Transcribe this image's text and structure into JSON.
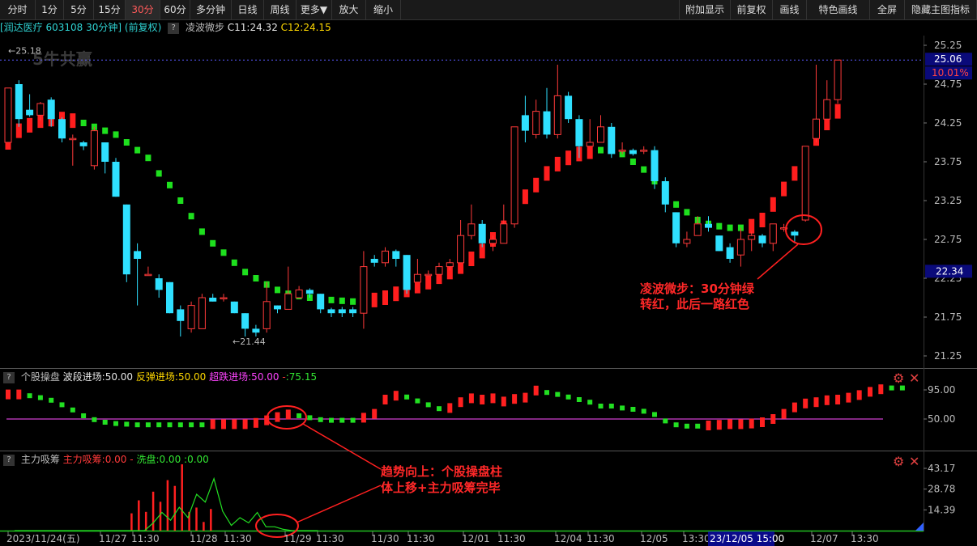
{
  "toolbar": {
    "left": [
      "分时",
      "1分",
      "5分",
      "15分",
      "30分",
      "60分",
      "多分钟",
      "日线",
      "周线",
      "更多▼",
      "放大",
      "缩小"
    ],
    "active": "30分",
    "right": [
      "附加显示",
      "前复权",
      "画线",
      "特色画线",
      "全屏",
      "隐藏主图指标"
    ]
  },
  "header": {
    "stock": "[润达医疗 603108 30分钟]",
    "adjust": "(前复权)",
    "indicator": "凌波微步",
    "c1": "C11:24.32",
    "c2": "C12:24.15",
    "watermark": "5牛共赢"
  },
  "panel2_header": {
    "name": "个股操盘",
    "a": "波段进场:50.00",
    "b": "反弹进场:50.00",
    "c": "超跌进场:50.00",
    "d": "-",
    "e": ":75.15"
  },
  "panel3_header": {
    "name": "主力吸筹",
    "a": "主力吸筹:0.00",
    "b": "-",
    "c": "洗盘:0.00",
    "d": ":0.00"
  },
  "annotations": {
    "a1_line1": "凌波微步：30分钟绿",
    "a1_line2": "转红，此后一路红色",
    "a2_line1": "趋势向上：个股操盘柱",
    "a2_line2": "体上移+主力吸筹完毕"
  },
  "colors": {
    "up": "#ff3a3a",
    "down": "#2fe0ff",
    "ma_up": "#ff1e1e",
    "ma_down": "#1ee01e",
    "bg": "#000000"
  },
  "chart_data": [
    {
      "type": "candlestick",
      "name": "main",
      "y_ticks": [
        "25.25",
        "24.75",
        "24.25",
        "23.75",
        "23.25",
        "22.75",
        "22.25",
        "21.75",
        "21.25"
      ],
      "ylim": [
        21.0,
        25.5
      ],
      "high_label": "25.18",
      "low_label": "21.44",
      "price_tag": "25.06",
      "pct_tag": "10.01%",
      "cursor_tag": "22.34",
      "candles": [
        [
          24.0,
          24.7,
          24.3,
          24.0
        ],
        [
          24.75,
          24.3,
          24.8,
          24.2
        ],
        [
          24.42,
          24.35,
          24.62,
          24.33
        ],
        [
          24.35,
          24.5,
          24.52,
          24.28
        ],
        [
          24.55,
          24.3,
          24.58,
          24.2
        ],
        [
          24.3,
          24.05,
          24.32,
          24.0
        ],
        [
          24.05,
          24.05,
          24.1,
          23.7
        ],
        [
          24.0,
          23.95,
          24.02,
          23.9
        ],
        [
          23.7,
          24.15,
          24.2,
          23.65
        ],
        [
          24.0,
          23.75,
          24.0,
          23.6
        ],
        [
          23.75,
          23.3,
          23.8,
          23.3
        ],
        [
          23.2,
          22.3,
          23.2,
          22.2
        ],
        [
          22.6,
          22.5,
          22.7,
          21.9
        ],
        [
          22.3,
          22.3,
          22.4,
          22.3
        ],
        [
          22.25,
          22.1,
          22.3,
          22.0
        ],
        [
          22.2,
          21.8,
          22.2,
          21.8
        ],
        [
          21.85,
          21.7,
          21.9,
          21.5
        ],
        [
          21.6,
          21.9,
          21.95,
          21.55
        ],
        [
          21.6,
          22.0,
          22.05,
          21.6
        ],
        [
          22.0,
          21.95,
          22.05,
          21.95
        ],
        [
          22.0,
          22.0,
          22.05,
          21.95
        ],
        [
          21.95,
          21.8,
          21.95,
          21.8
        ],
        [
          21.8,
          21.6,
          21.8,
          21.5
        ],
        [
          21.6,
          21.55,
          21.65,
          21.5
        ],
        [
          21.6,
          21.95,
          22.2,
          21.55
        ],
        [
          21.9,
          21.85,
          21.9,
          21.8
        ],
        [
          21.85,
          22.05,
          22.4,
          21.85
        ],
        [
          22.0,
          22.1,
          22.15,
          22.0
        ],
        [
          22.1,
          22.05,
          22.12,
          22.0
        ],
        [
          22.05,
          21.85,
          22.05,
          21.8
        ],
        [
          21.85,
          21.8,
          21.87,
          21.75
        ],
        [
          21.85,
          21.8,
          21.88,
          21.75
        ],
        [
          21.85,
          21.8,
          21.88,
          21.75
        ],
        [
          21.8,
          22.4,
          22.6,
          21.6
        ],
        [
          22.5,
          22.45,
          22.55,
          22.4
        ],
        [
          22.45,
          22.6,
          22.65,
          22.4
        ],
        [
          22.6,
          22.5,
          22.62,
          22.4
        ],
        [
          22.55,
          22.1,
          22.55,
          22.05
        ],
        [
          22.2,
          22.3,
          22.5,
          22.2
        ],
        [
          22.3,
          22.3,
          22.35,
          22.3
        ],
        [
          22.3,
          22.4,
          22.45,
          22.3
        ],
        [
          22.4,
          22.45,
          22.5,
          22.35
        ],
        [
          22.45,
          22.8,
          23.0,
          22.45
        ],
        [
          22.8,
          22.95,
          23.2,
          22.75
        ],
        [
          22.95,
          22.7,
          23.0,
          22.65
        ],
        [
          22.7,
          22.75,
          22.8,
          22.6
        ],
        [
          22.7,
          22.95,
          23.2,
          22.7
        ],
        [
          22.95,
          24.2,
          24.2,
          22.9
        ],
        [
          24.35,
          24.15,
          24.6,
          24.0
        ],
        [
          24.1,
          24.4,
          24.55,
          24.05
        ],
        [
          24.4,
          24.1,
          24.7,
          24.05
        ],
        [
          24.1,
          24.6,
          25.0,
          24.05
        ],
        [
          24.6,
          24.3,
          24.65,
          24.25
        ],
        [
          24.3,
          23.95,
          24.35,
          23.8
        ],
        [
          23.95,
          24.0,
          24.3,
          23.95
        ],
        [
          24.0,
          24.2,
          24.35,
          24.0
        ],
        [
          24.2,
          23.85,
          24.25,
          23.8
        ],
        [
          23.9,
          23.9,
          24.0,
          23.85
        ],
        [
          23.9,
          23.85,
          23.92,
          23.83
        ],
        [
          23.9,
          23.9,
          23.95,
          23.85
        ],
        [
          23.9,
          23.5,
          23.95,
          23.4
        ],
        [
          23.5,
          23.2,
          23.55,
          23.1
        ],
        [
          23.1,
          22.7,
          23.1,
          22.65
        ],
        [
          22.7,
          22.75,
          22.85,
          22.65
        ],
        [
          22.8,
          22.95,
          23.05,
          22.8
        ],
        [
          22.95,
          22.9,
          23.05,
          22.85
        ],
        [
          22.8,
          22.6,
          22.8,
          22.6
        ],
        [
          22.65,
          22.5,
          22.7,
          22.45
        ],
        [
          22.55,
          22.75,
          22.9,
          22.4
        ],
        [
          22.75,
          22.8,
          22.85,
          22.6
        ],
        [
          22.8,
          22.7,
          22.82,
          22.65
        ],
        [
          22.7,
          22.95,
          22.95,
          22.6
        ],
        [
          22.9,
          22.9,
          22.95,
          22.85
        ],
        [
          22.85,
          22.8,
          22.87,
          22.7
        ],
        [
          23.0,
          23.95,
          23.95,
          22.98
        ],
        [
          24.05,
          24.3,
          25.0,
          24.0
        ],
        [
          24.3,
          24.55,
          24.8,
          24.3
        ],
        [
          24.55,
          25.06,
          25.06,
          24.5
        ]
      ],
      "ma": [
        [
          24.0,
          "r"
        ],
        [
          24.15,
          "r"
        ],
        [
          24.22,
          "r"
        ],
        [
          24.28,
          "r"
        ],
        [
          24.3,
          "r"
        ],
        [
          24.3,
          "r"
        ],
        [
          24.28,
          "r"
        ],
        [
          24.25,
          "g"
        ],
        [
          24.2,
          "g"
        ],
        [
          24.15,
          "g"
        ],
        [
          24.1,
          "g"
        ],
        [
          24.0,
          "g"
        ],
        [
          23.9,
          "g"
        ],
        [
          23.8,
          "g"
        ],
        [
          23.6,
          "g"
        ],
        [
          23.45,
          "g"
        ],
        [
          23.25,
          "g"
        ],
        [
          23.05,
          "g"
        ],
        [
          22.85,
          "g"
        ],
        [
          22.7,
          "g"
        ],
        [
          22.58,
          "g"
        ],
        [
          22.45,
          "g"
        ],
        [
          22.33,
          "g"
        ],
        [
          22.25,
          "g"
        ],
        [
          22.17,
          "g"
        ],
        [
          22.1,
          "g"
        ],
        [
          22.05,
          "g"
        ],
        [
          22.02,
          "g"
        ],
        [
          22.0,
          "g"
        ],
        [
          21.98,
          "g"
        ],
        [
          21.97,
          "g"
        ],
        [
          21.96,
          "g"
        ],
        [
          21.95,
          "g"
        ],
        [
          21.95,
          "r"
        ],
        [
          21.97,
          "r"
        ],
        [
          22.0,
          "r"
        ],
        [
          22.05,
          "r"
        ],
        [
          22.1,
          "r"
        ],
        [
          22.15,
          "r"
        ],
        [
          22.2,
          "r"
        ],
        [
          22.27,
          "r"
        ],
        [
          22.33,
          "r"
        ],
        [
          22.4,
          "r"
        ],
        [
          22.5,
          "r"
        ],
        [
          22.6,
          "r"
        ],
        [
          22.75,
          "r"
        ],
        [
          22.9,
          "r"
        ],
        [
          23.1,
          "r"
        ],
        [
          23.3,
          "r"
        ],
        [
          23.45,
          "r"
        ],
        [
          23.6,
          "r"
        ],
        [
          23.72,
          "r"
        ],
        [
          23.8,
          "r"
        ],
        [
          23.85,
          "r"
        ],
        [
          23.88,
          "r"
        ],
        [
          23.9,
          "g"
        ],
        [
          23.9,
          "g"
        ],
        [
          23.85,
          "g"
        ],
        [
          23.75,
          "g"
        ],
        [
          23.65,
          "g"
        ],
        [
          23.5,
          "g"
        ],
        [
          23.35,
          "g"
        ],
        [
          23.2,
          "g"
        ],
        [
          23.1,
          "g"
        ],
        [
          23.0,
          "g"
        ],
        [
          22.95,
          "g"
        ],
        [
          22.92,
          "g"
        ],
        [
          22.9,
          "g"
        ],
        [
          22.9,
          "g"
        ],
        [
          22.92,
          "r"
        ],
        [
          23.0,
          "r"
        ],
        [
          23.2,
          "r"
        ],
        [
          23.4,
          "r"
        ],
        [
          23.6,
          "r"
        ],
        [
          23.85,
          "r"
        ],
        [
          24.05,
          "r"
        ],
        [
          24.25,
          "r"
        ],
        [
          24.4,
          "r"
        ]
      ]
    },
    {
      "type": "bar",
      "name": "个股操盘",
      "y_ticks": [
        "95.00",
        "50.00"
      ],
      "ylim": [
        38,
        100
      ],
      "level": 50,
      "values": [
        [
          88,
          "r"
        ],
        [
          88,
          "r"
        ],
        [
          86,
          "g"
        ],
        [
          83,
          "g"
        ],
        [
          79,
          "g"
        ],
        [
          72,
          "g"
        ],
        [
          64,
          "g"
        ],
        [
          55,
          "g"
        ],
        [
          49,
          "g"
        ],
        [
          45,
          "g"
        ],
        [
          43,
          "g"
        ],
        [
          42,
          "g"
        ],
        [
          41,
          "g"
        ],
        [
          41,
          "g"
        ],
        [
          41,
          "g"
        ],
        [
          41,
          "g"
        ],
        [
          41,
          "g"
        ],
        [
          41,
          "g"
        ],
        [
          41,
          "g"
        ],
        [
          42,
          "r"
        ],
        [
          42,
          "r"
        ],
        [
          42,
          "r"
        ],
        [
          42,
          "r"
        ],
        [
          44,
          "r"
        ],
        [
          48,
          "r"
        ],
        [
          53,
          "r"
        ],
        [
          57,
          "r"
        ],
        [
          55,
          "g"
        ],
        [
          52,
          "g"
        ],
        [
          49,
          "g"
        ],
        [
          48,
          "g"
        ],
        [
          48,
          "g"
        ],
        [
          48,
          "g"
        ],
        [
          52,
          "r"
        ],
        [
          58,
          "r"
        ],
        [
          80,
          "r"
        ],
        [
          86,
          "r"
        ],
        [
          84,
          "g"
        ],
        [
          78,
          "g"
        ],
        [
          72,
          "g"
        ],
        [
          66,
          "g"
        ],
        [
          67,
          "r"
        ],
        [
          76,
          "r"
        ],
        [
          82,
          "r"
        ],
        [
          80,
          "r"
        ],
        [
          82,
          "r"
        ],
        [
          77,
          "r"
        ],
        [
          81,
          "r"
        ],
        [
          83,
          "r"
        ],
        [
          94,
          "r"
        ],
        [
          91,
          "g"
        ],
        [
          88,
          "g"
        ],
        [
          84,
          "g"
        ],
        [
          80,
          "g"
        ],
        [
          76,
          "g"
        ],
        [
          70,
          "g"
        ],
        [
          70,
          "g"
        ],
        [
          67,
          "g"
        ],
        [
          65,
          "g"
        ],
        [
          62,
          "g"
        ],
        [
          57,
          "g"
        ],
        [
          47,
          "g"
        ],
        [
          41,
          "g"
        ],
        [
          39,
          "g"
        ],
        [
          39,
          "g"
        ],
        [
          40,
          "r"
        ],
        [
          41,
          "r"
        ],
        [
          42,
          "r"
        ],
        [
          42,
          "r"
        ],
        [
          43,
          "r"
        ],
        [
          45,
          "r"
        ],
        [
          50,
          "r"
        ],
        [
          58,
          "r"
        ],
        [
          68,
          "r"
        ],
        [
          74,
          "r"
        ],
        [
          76,
          "r"
        ],
        [
          79,
          "r"
        ],
        [
          80,
          "r"
        ],
        [
          83,
          "r"
        ],
        [
          87,
          "r"
        ],
        [
          92,
          "r"
        ],
        [
          96,
          "r"
        ],
        [
          98,
          "g"
        ],
        [
          98,
          "g"
        ]
      ]
    },
    {
      "type": "bar",
      "name": "主力吸筹",
      "y_ticks": [
        "43.17",
        "28.78",
        "14.39"
      ],
      "ylim": [
        0,
        50
      ],
      "x_ticks": [
        "2023/11/24(五)",
        "11/27",
        "11:30",
        "11/28",
        "11:30",
        "11/29",
        "11:30",
        "11/30",
        "11:30",
        "12/01",
        "11:30",
        "12/04",
        "11:30",
        "12/05",
        "13:30",
        "23/12/05 15:00",
        "12/07",
        "13:30"
      ],
      "red_bars": [
        [
          16,
          12
        ],
        [
          17,
          21
        ],
        [
          18,
          13
        ],
        [
          19,
          27
        ],
        [
          20,
          20
        ],
        [
          21,
          35
        ],
        [
          22,
          31
        ],
        [
          23,
          46
        ],
        [
          24,
          13
        ],
        [
          25,
          16
        ],
        [
          26,
          6
        ],
        [
          27,
          15
        ]
      ],
      "green_line": [
        0,
        0,
        0,
        0,
        0,
        0,
        0,
        0,
        0,
        0,
        0,
        0,
        0,
        0,
        0,
        0,
        6,
        14,
        8,
        18,
        10,
        28,
        22,
        40,
        15,
        4,
        10,
        6,
        14,
        3,
        3,
        1,
        0,
        0,
        0,
        0
      ]
    }
  ]
}
